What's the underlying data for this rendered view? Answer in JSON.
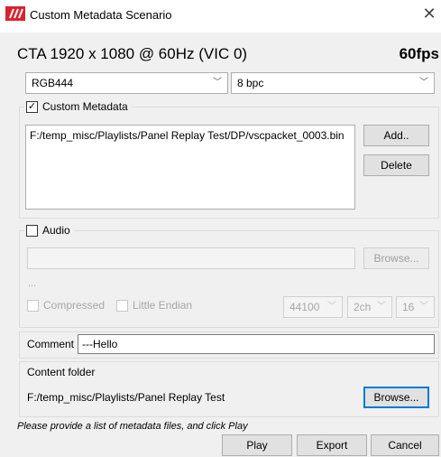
{
  "window": {
    "title": "Custom Metadata Scenario",
    "close_glyph": "✕",
    "icon": "app-logo-icon"
  },
  "mode": {
    "label": "CTA 1920 x 1080 @ 60Hz (VIC 0)",
    "fps": "60fps"
  },
  "color_format": {
    "value": "RGB444"
  },
  "bit_depth": {
    "value": "8 bpc"
  },
  "custom_metadata": {
    "label": "Custom Metadata",
    "checked": true,
    "check_glyph": "✓",
    "files": [
      "F:/temp_misc/Playlists/Panel Replay Test/DP/vscpacket_0003.bin"
    ],
    "add_label": "Add..",
    "delete_label": "Delete"
  },
  "audio": {
    "label": "Audio",
    "checked": false,
    "file_value": "",
    "browse_label": "Browse...",
    "info": "...",
    "compressed_label": "Compressed",
    "little_endian_label": "Little Endian",
    "sample_rate": "44100",
    "channels": "2ch",
    "bits": "16"
  },
  "comment": {
    "label": "Comment",
    "value": "---Hello"
  },
  "content_folder": {
    "label": "Content folder",
    "path": "F:/temp_misc/Playlists/Panel Replay Test",
    "browse_label": "Browse..."
  },
  "status": "Please provide a list of metadata files, and click Play",
  "actions": {
    "play_label": "Play",
    "export_label": "Export",
    "cancel_label": "Cancel"
  },
  "caret_glyph": "﹀",
  "colors": {
    "brand_red": "#d9232e",
    "focus_blue": "#0078d7"
  }
}
